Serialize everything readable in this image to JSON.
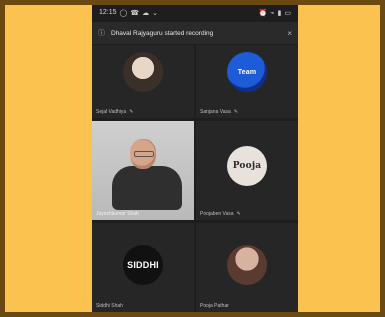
{
  "status_bar": {
    "time": "12:15",
    "left_icons": [
      "whatsapp-icon",
      "phone-icon",
      "ghost-icon",
      "chevron-down-icon"
    ],
    "right_icons": [
      "alarm-icon",
      "wifi-icon",
      "signal-icon",
      "battery-icon"
    ]
  },
  "banner": {
    "info_icon": "info-icon",
    "message": "Dhaval Rajyaguru started recording",
    "close_icon": "close-icon"
  },
  "participants": [
    {
      "name": "Sejal Vadhiya",
      "avatar_text": ""
    },
    {
      "name": "Sanjana Vasa",
      "avatar_text": "Team"
    },
    {
      "name": "Jayeshkumar Shah",
      "avatar_text": ""
    },
    {
      "name": "Poojaben Vasa",
      "avatar_text": "Pooja"
    },
    {
      "name": "Siddhi Shah",
      "avatar_text": "SIDDHI"
    },
    {
      "name": "Pooja Pathar",
      "avatar_text": ""
    }
  ],
  "colors": {
    "outer_frame": "#6b4a12",
    "inner_frame": "#fbc24f",
    "app_bg": "#1e1e1e",
    "tile_bg": "#262626"
  }
}
